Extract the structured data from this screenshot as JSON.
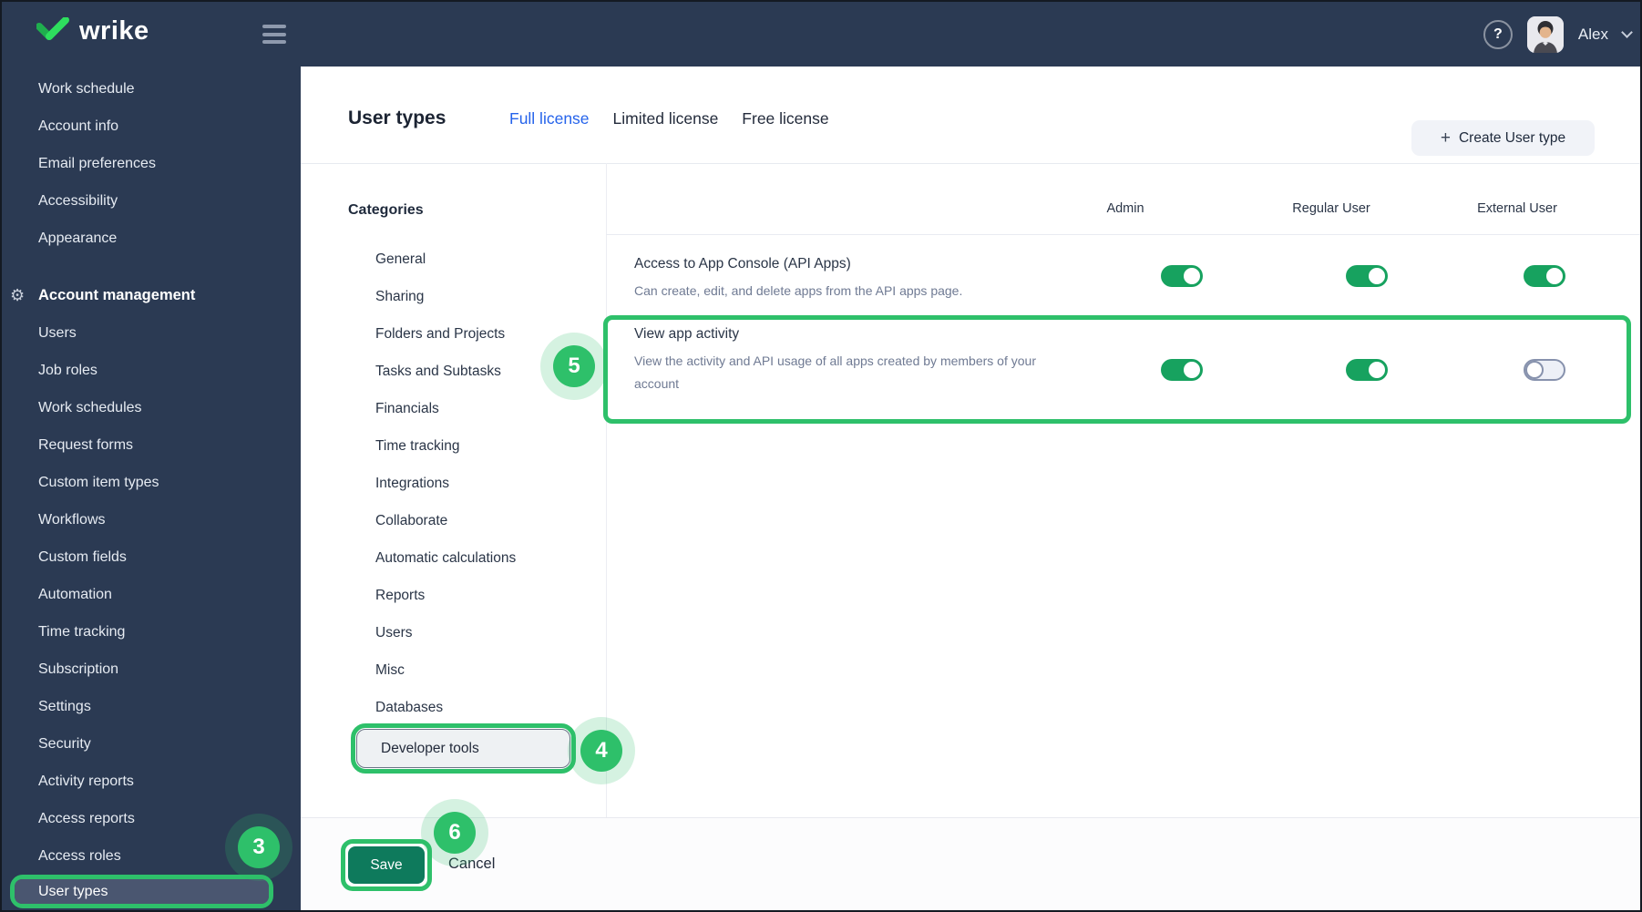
{
  "topbar": {
    "logo_text": "wrike",
    "user_name": "Alex",
    "help_label": "?"
  },
  "sidebar": {
    "items_top": [
      "Work schedule",
      "Account info",
      "Email preferences",
      "Accessibility",
      "Appearance"
    ],
    "section_label": "Account management",
    "items": [
      "Users",
      "Job roles",
      "Work schedules",
      "Request forms",
      "Custom item types",
      "Workflows",
      "Custom fields",
      "Automation",
      "Time tracking",
      "Subscription",
      "Settings",
      "Security",
      "Activity reports",
      "Access reports",
      "Access roles"
    ],
    "selected_item": "User types"
  },
  "header": {
    "title": "User types",
    "tabs": [
      {
        "label": "Full license",
        "active": true
      },
      {
        "label": "Limited license",
        "active": false
      },
      {
        "label": "Free license",
        "active": false
      }
    ],
    "create_button": {
      "icon": "+",
      "label": "Create User type"
    }
  },
  "categories": {
    "heading": "Categories",
    "items": [
      "General",
      "Sharing",
      "Folders and Projects",
      "Tasks and Subtasks",
      "Financials",
      "Time tracking",
      "Integrations",
      "Collaborate",
      "Automatic calculations",
      "Reports",
      "Users",
      "Misc",
      "Databases"
    ],
    "selected": "Developer tools"
  },
  "table": {
    "columns": [
      "Admin",
      "Regular User",
      "External User"
    ],
    "rows": [
      {
        "title": "Access to App Console (API Apps)",
        "description": "Can create, edit, and delete apps from the API apps page.",
        "toggles": [
          true,
          true,
          true
        ]
      },
      {
        "title": "View app activity",
        "description": "View the activity and API usage of all apps created by members of your account",
        "toggles": [
          true,
          true,
          false
        ],
        "highlighted": true
      }
    ]
  },
  "footer": {
    "save_label": "Save",
    "cancel_label": "Cancel"
  },
  "annotations": {
    "color": "#2EC06A",
    "badges": [
      {
        "number": "3",
        "target": "sidebar-user-types"
      },
      {
        "number": "4",
        "target": "category-developer-tools"
      },
      {
        "number": "5",
        "target": "view-app-activity-row"
      },
      {
        "number": "6",
        "target": "save-button"
      }
    ]
  },
  "colors": {
    "topbar_bg": "#2B3A53",
    "selected_pill_bg": "#4A5670",
    "tab_active": "#2563EB",
    "toggle_on": "#17A25F",
    "annotation_green": "#2EC06A",
    "save_button_bg": "#0E7A5C"
  }
}
